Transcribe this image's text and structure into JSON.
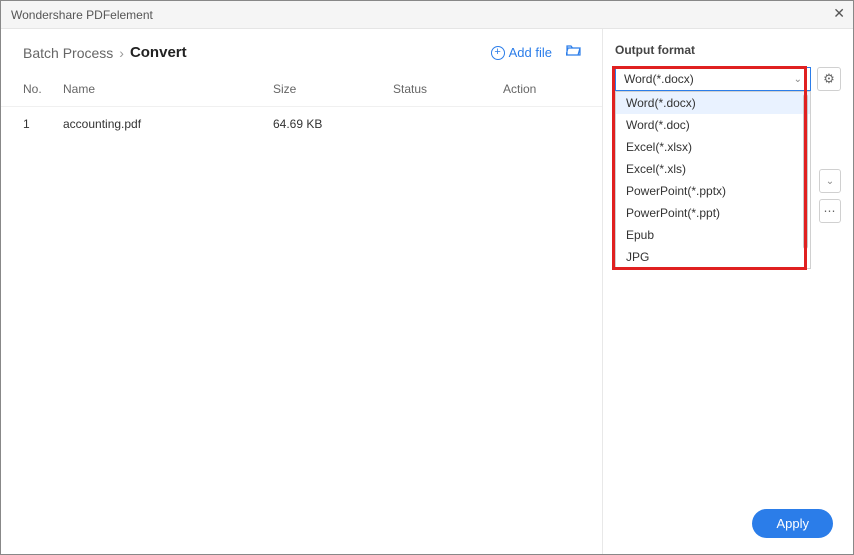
{
  "window": {
    "title": "Wondershare PDFelement"
  },
  "breadcrumb": {
    "root": "Batch Process",
    "current": "Convert"
  },
  "toolbar": {
    "add_file": "Add file"
  },
  "table": {
    "headers": {
      "no": "No.",
      "name": "Name",
      "size": "Size",
      "status": "Status",
      "action": "Action"
    },
    "rows": [
      {
        "no": "1",
        "name": "accounting.pdf",
        "size": "64.69 KB",
        "status": "",
        "action": ""
      }
    ]
  },
  "sidebar": {
    "output_format_label": "Output format",
    "selected": "Word(*.docx)",
    "options": [
      "Word(*.docx)",
      "Word(*.doc)",
      "Excel(*.xlsx)",
      "Excel(*.xls)",
      "PowerPoint(*.pptx)",
      "PowerPoint(*.ppt)",
      "Epub",
      "JPG"
    ]
  },
  "footer": {
    "apply": "Apply"
  }
}
